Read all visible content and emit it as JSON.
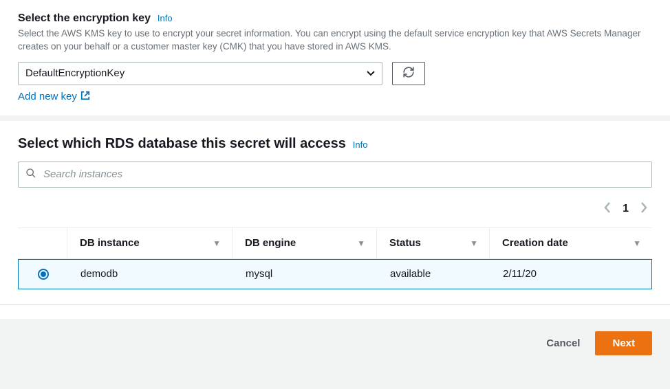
{
  "encryption": {
    "title": "Select the encryption key",
    "info": "Info",
    "desc": "Select the AWS KMS key to use to encrypt your secret information. You can encrypt using the default service encryption key that AWS Secrets Manager creates on your behalf or a customer master key (CMK) that you have stored in AWS KMS.",
    "selected": "DefaultEncryptionKey",
    "add_new": "Add new key"
  },
  "database": {
    "title": "Select which RDS database this secret will access",
    "info": "Info",
    "search_placeholder": "Search instances",
    "page": "1",
    "columns": {
      "db_instance": "DB instance",
      "db_engine": "DB engine",
      "status": "Status",
      "creation_date": "Creation date"
    },
    "rows": [
      {
        "selected": true,
        "db_instance": "demodb",
        "db_engine": "mysql",
        "status": "available",
        "creation_date": "2/11/20"
      }
    ]
  },
  "footer": {
    "cancel": "Cancel",
    "next": "Next"
  }
}
